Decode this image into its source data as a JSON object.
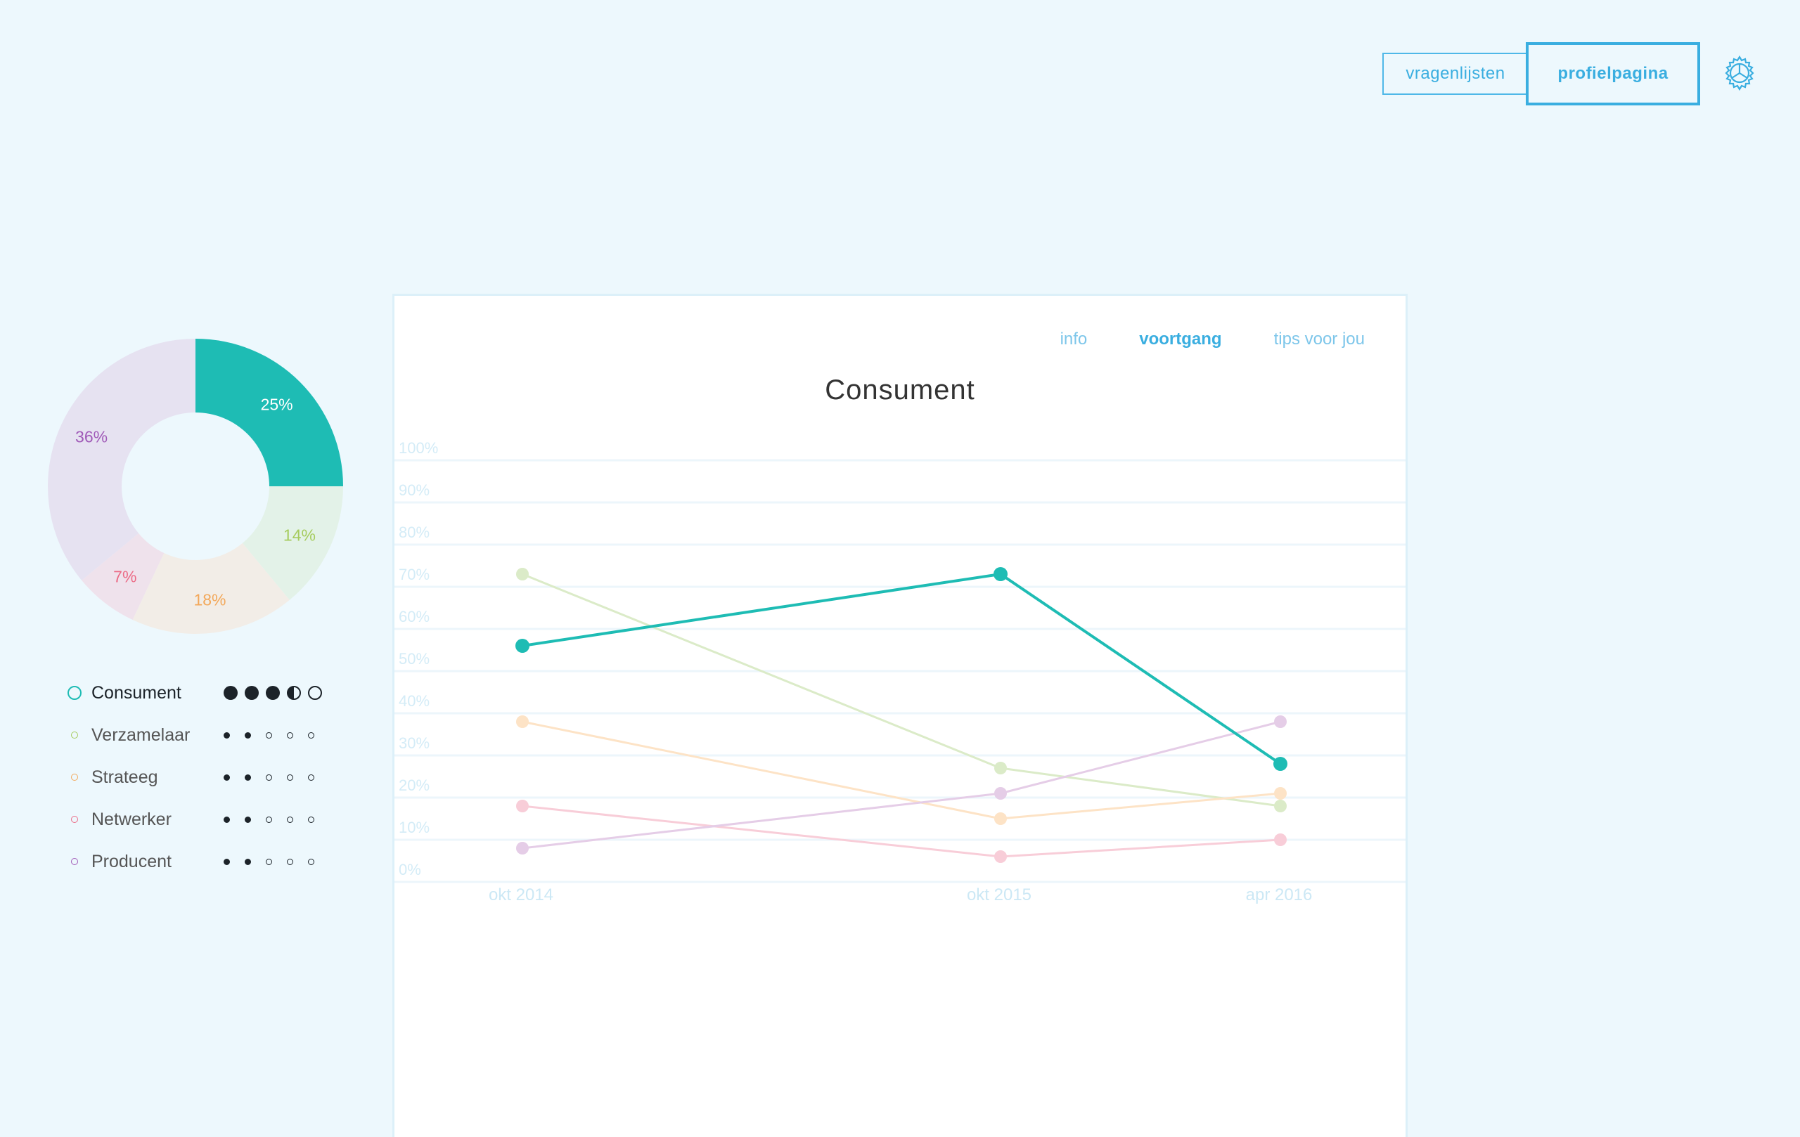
{
  "nav": {
    "questionnaires_label": "vragenlijsten",
    "profile_label": "profielpagina",
    "settings_icon": "gear-icon"
  },
  "donut": {
    "slices": [
      {
        "name": "Consument",
        "percent": 25,
        "label": "25%",
        "color": "#1ebcb4",
        "label_color": "#ffffff"
      },
      {
        "name": "Verzamelaar",
        "percent": 14,
        "label": "14%",
        "color": "#e3f2e8",
        "label_color": "#a6cc5e"
      },
      {
        "name": "Strateeg",
        "percent": 18,
        "label": "18%",
        "color": "#f2ede7",
        "label_color": "#f3a85a"
      },
      {
        "name": "Netwerker",
        "percent": 7,
        "label": "7%",
        "color": "#efe2ec",
        "label_color": "#ec6b86"
      },
      {
        "name": "Producent",
        "percent": 36,
        "label": "36%",
        "color": "#e6e2f1",
        "label_color": "#a05ab8"
      }
    ]
  },
  "legend": [
    {
      "name": "Consument",
      "color": "#1ebcb4",
      "active": true,
      "rating": [
        1,
        1,
        1,
        0.5,
        0
      ]
    },
    {
      "name": "Verzamelaar",
      "color": "#a6cc5e",
      "active": false,
      "rating": [
        1,
        1,
        0,
        0,
        0
      ]
    },
    {
      "name": "Strateeg",
      "color": "#f3a85a",
      "active": false,
      "rating": [
        1,
        1,
        0,
        0,
        0
      ]
    },
    {
      "name": "Netwerker",
      "color": "#ec6b86",
      "active": false,
      "rating": [
        1,
        1,
        0,
        0,
        0
      ]
    },
    {
      "name": "Producent",
      "color": "#a05ab8",
      "active": false,
      "rating": [
        1,
        1,
        0,
        0,
        0
      ]
    }
  ],
  "card": {
    "tabs": [
      {
        "label": "info",
        "active": false
      },
      {
        "label": "voortgang",
        "active": true
      },
      {
        "label": "tips voor jou",
        "active": false
      }
    ]
  },
  "chart_data": {
    "type": "line",
    "title": "Consument",
    "x": [
      "okt 2014",
      "okt 2015",
      "apr 2016"
    ],
    "ylim": [
      0,
      100
    ],
    "yticks": [
      "0%",
      "10%",
      "20%",
      "30%",
      "40%",
      "50%",
      "60%",
      "70%",
      "80%",
      "90%",
      "100%"
    ],
    "grid": true,
    "series": [
      {
        "name": "Verzamelaar",
        "values": [
          70,
          24,
          15
        ],
        "color": "#dbebc8",
        "highlight": false
      },
      {
        "name": "Strateeg",
        "values": [
          35,
          12,
          18
        ],
        "color": "#fde3c6",
        "highlight": false
      },
      {
        "name": "Netwerker",
        "values": [
          15,
          3,
          7
        ],
        "color": "#f8cdd8",
        "highlight": false
      },
      {
        "name": "Producent",
        "values": [
          5,
          18,
          35
        ],
        "color": "#e5cde7",
        "highlight": false
      },
      {
        "name": "Consument",
        "values": [
          53,
          70,
          25
        ],
        "color": "#1ebcb4",
        "highlight": true
      }
    ]
  }
}
